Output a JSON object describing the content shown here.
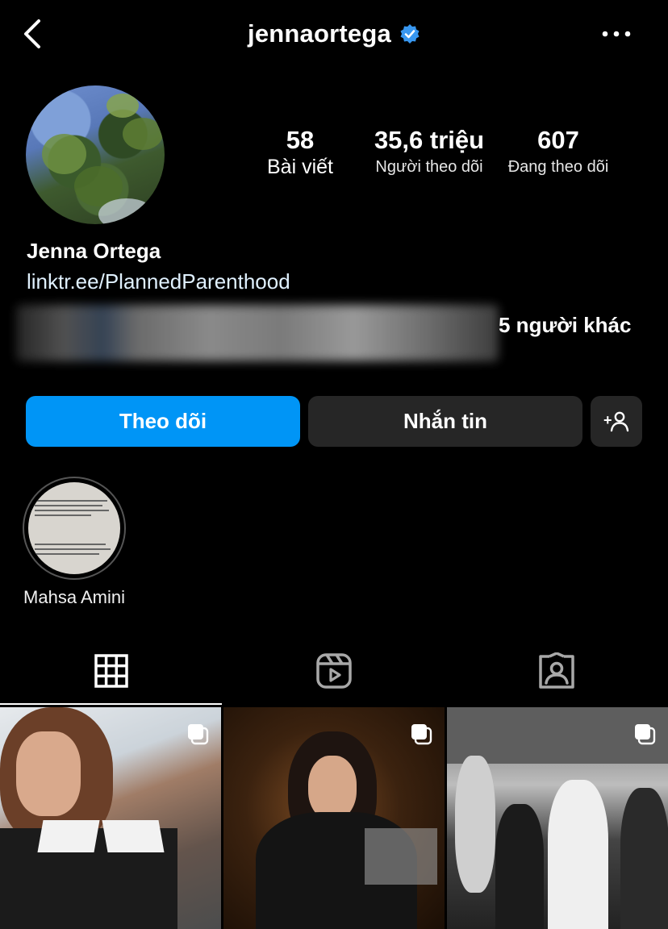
{
  "header": {
    "username": "jennaortega",
    "verified": true,
    "back_icon": "chevron-left-icon",
    "more_icon": "more-horizontal-icon"
  },
  "profile": {
    "full_name": "Jenna Ortega",
    "link": "linktr.ee/PlannedParenthood",
    "followed_by_suffix": "5 người khác"
  },
  "stats": {
    "posts": {
      "value": "58",
      "label": "Bài viết"
    },
    "followers": {
      "value": "35,6 triệu",
      "label": "Người theo dõi"
    },
    "following": {
      "value": "607",
      "label": "Đang theo dõi"
    }
  },
  "actions": {
    "follow_label": "Theo dõi",
    "message_label": "Nhắn tin",
    "add_user_icon": "add-user-icon"
  },
  "highlights": [
    {
      "label": "Mahsa Amini"
    }
  ],
  "tabs": [
    {
      "name": "grid-icon",
      "active": true
    },
    {
      "name": "reels-icon",
      "active": false
    },
    {
      "name": "tagged-icon",
      "active": false
    }
  ],
  "colors": {
    "accent": "#0095f6",
    "background": "#000000",
    "secondary_button": "#262626",
    "verified": "#3897f0"
  }
}
